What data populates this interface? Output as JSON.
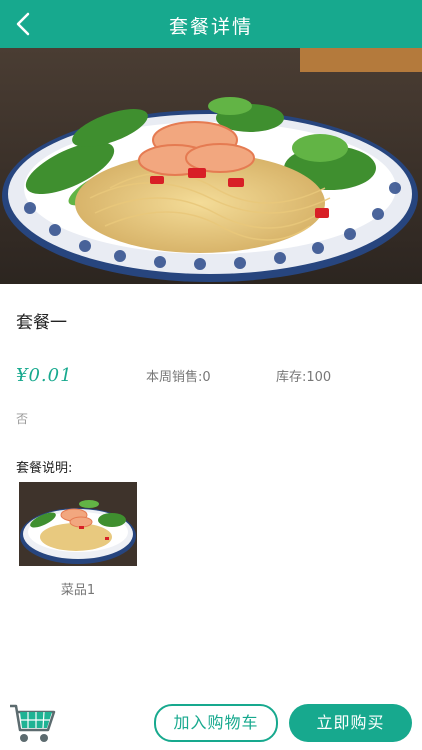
{
  "header": {
    "title": "套餐详情",
    "back_icon": "chevron-left-icon"
  },
  "product": {
    "title": "套餐一",
    "price": "¥0.01",
    "weekly_sales": "本周销售:0",
    "stock": "库存:100",
    "note": "否"
  },
  "description": {
    "label": "套餐说明:",
    "items": [
      {
        "name": "菜品1"
      }
    ]
  },
  "footer": {
    "cart_icon": "shopping-basket-icon",
    "add_to_cart_label": "加入购物车",
    "buy_now_label": "立即购买"
  },
  "colors": {
    "accent": "#17a98e"
  }
}
